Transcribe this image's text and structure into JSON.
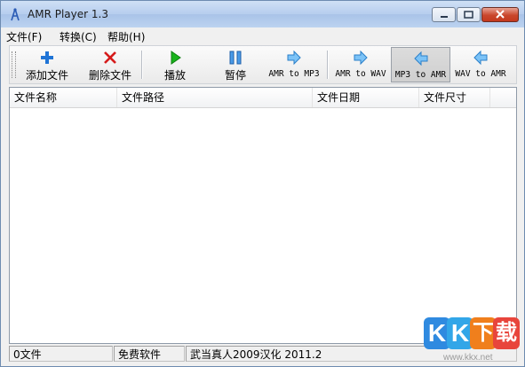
{
  "window": {
    "title": "AMR Player 1.3",
    "buttons": {
      "minimize": "▭",
      "maximize": "□",
      "close": "✕"
    }
  },
  "menu": [
    "文件(F)",
    "转换(C)",
    "帮助(H)"
  ],
  "toolbar": {
    "add": "添加文件",
    "delete": "删除文件",
    "play": "播放",
    "pause": "暂停",
    "amr_to_mp3": "AMR to MP3",
    "amr_to_wav": "AMR to WAV",
    "mp3_to_amr": "MP3 to AMR",
    "wav_to_amr": "WAV to AMR"
  },
  "list": {
    "columns": [
      "文件名称",
      "文件路径",
      "文件日期",
      "文件尺寸"
    ],
    "rows": []
  },
  "status": [
    "0文件",
    "免费软件",
    "武当真人2009汉化   2011.2"
  ],
  "watermark": {
    "letters": [
      "K",
      "K",
      "下",
      "载"
    ],
    "url": "www.kkx.net"
  },
  "colors": {
    "accent": "#1f74d6",
    "play_green": "#18b31b",
    "delete_red": "#d61b1b",
    "close_red": "#c4391e"
  }
}
